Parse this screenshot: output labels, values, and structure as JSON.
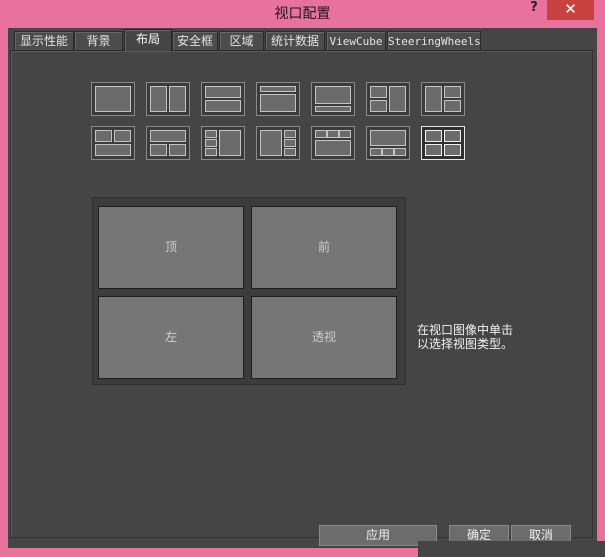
{
  "window": {
    "title": "视口配置",
    "help_label": "?",
    "close_label": "✕"
  },
  "tabs": [
    {
      "label": "显示性能"
    },
    {
      "label": "背景"
    },
    {
      "label": "布局"
    },
    {
      "label": "安全框"
    },
    {
      "label": "区域"
    },
    {
      "label": "统计数据"
    },
    {
      "label": "ViewCube"
    },
    {
      "label": "SteeringWheels"
    }
  ],
  "active_tab": "布局",
  "layout_thumbnails": {
    "count": 14,
    "selected_index": 13
  },
  "viewports": [
    {
      "label": "顶"
    },
    {
      "label": "前"
    },
    {
      "label": "左"
    },
    {
      "label": "透视"
    }
  ],
  "hint": {
    "line1": "在视口图像中单击",
    "line2": "以选择视图类型。"
  },
  "buttons": {
    "apply": "应用",
    "ok": "确定",
    "cancel": "取消"
  }
}
